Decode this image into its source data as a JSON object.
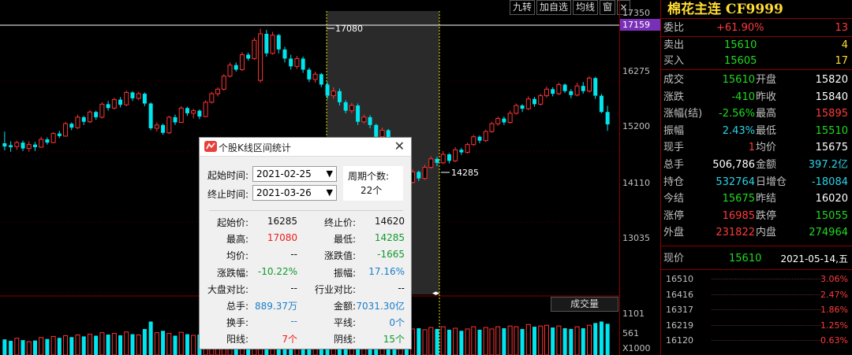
{
  "toolbar": {
    "btn1": "九转",
    "btn2": "加自选",
    "btn3": "均线",
    "btn4": "窗",
    "close": "×"
  },
  "axis": {
    "current_price": "17159",
    "labels": [
      "17350",
      "16275",
      "15200",
      "14110",
      "13035",
      "1101",
      "561",
      "X1000"
    ]
  },
  "chart_overlay": {
    "high_marker": "17080",
    "low_marker": "14285",
    "volume_label": "成交量"
  },
  "panel": {
    "title": "棉花主连 CF9999",
    "rows": [
      {
        "l1": "委比",
        "v1": "+61.90%",
        "v2": "13"
      },
      {
        "l1": "卖出",
        "v1": "15610",
        "v2": "4"
      },
      {
        "l1": "买入",
        "v1": "15605",
        "v2": "17"
      }
    ],
    "grid": [
      {
        "l1": "成交",
        "v1": "15610",
        "l2": "开盘",
        "v2": "15820"
      },
      {
        "l1": "涨跌",
        "v1": "-410",
        "l2": "昨收",
        "v2": "15840"
      },
      {
        "l1": "涨幅(结)",
        "v1": "-2.56%",
        "l2": "最高",
        "v2": "15895"
      },
      {
        "l1": "振幅",
        "v1": "2.43%",
        "l2": "最低",
        "v2": "15510"
      },
      {
        "l1": "现手",
        "v1": "1",
        "l2": "均价",
        "v2": "15675"
      },
      {
        "l1": "总手",
        "v1": "506,786",
        "l2": "金额",
        "v2": "397.2亿"
      },
      {
        "l1": "持仓",
        "v1": "532764",
        "l2": "日增仓",
        "v2": "-18084"
      },
      {
        "l1": "今结",
        "v1": "15675",
        "l2": "昨结",
        "v2": "16020"
      },
      {
        "l1": "涨停",
        "v1": "16985",
        "l2": "跌停",
        "v2": "15055"
      },
      {
        "l1": "外盘",
        "v1": "231822",
        "l2": "内盘",
        "v2": "274964"
      }
    ],
    "now": {
      "label": "现价",
      "price": "15610",
      "date": "2021-05-14,五"
    },
    "ladder": [
      {
        "price": "16510",
        "pct": "3.06%"
      },
      {
        "price": "16416",
        "pct": "2.47%"
      },
      {
        "price": "16317",
        "pct": "1.86%"
      },
      {
        "price": "16219",
        "pct": "1.25%"
      },
      {
        "price": "16120",
        "pct": "0.63%"
      }
    ]
  },
  "dialog": {
    "title": "个股K线区间统计",
    "start_label": "起始时间:",
    "start_value": "2021-02-25",
    "end_label": "终止时间:",
    "end_value": "2021-03-26",
    "period_label": "周期个数:",
    "period_value": "22个",
    "stats": [
      {
        "l1": "起始价:",
        "v1": "16285",
        "c1": "black",
        "l2": "终止价:",
        "v2": "14620",
        "c2": "black"
      },
      {
        "l1": "最高:",
        "v1": "17080",
        "c1": "red",
        "l2": "最低:",
        "v2": "14285",
        "c2": "green"
      },
      {
        "l1": "均价:",
        "v1": "--",
        "c1": "black",
        "l2": "涨跌值:",
        "v2": "-1665",
        "c2": "green"
      },
      {
        "l1": "涨跌幅:",
        "v1": "-10.22%",
        "c1": "green",
        "l2": "振幅:",
        "v2": "17.16%",
        "c2": "blue"
      },
      {
        "l1": "大盘对比:",
        "v1": "--",
        "c1": "black",
        "l2": "行业对比:",
        "v2": "--",
        "c2": "black"
      },
      {
        "l1": "总手:",
        "v1": "889.37万",
        "c1": "blue",
        "l2": "金额:",
        "v2": "7031.30亿",
        "c2": "blue"
      },
      {
        "l1": "换手:",
        "v1": "--",
        "c1": "blue",
        "l2": "平线:",
        "v2": "0个",
        "c2": "blue"
      },
      {
        "l1": "阳线:",
        "v1": "7个",
        "c1": "red",
        "l2": "阴线:",
        "v2": "15个",
        "c2": "green"
      }
    ]
  },
  "chart_data": {
    "type": "candlestick",
    "series_colors": {
      "up": "#ff3333",
      "down": "#00e5ee"
    },
    "y_range": [
      13000,
      17350
    ],
    "candles": [
      [
        15320,
        15270,
        15210,
        15500
      ],
      [
        15290,
        15260,
        15190,
        15350
      ],
      [
        15270,
        15330,
        15220,
        15360
      ],
      [
        15330,
        15240,
        15200,
        15360
      ],
      [
        15240,
        15300,
        15190,
        15350
      ],
      [
        15300,
        15260,
        15200,
        15340
      ],
      [
        15260,
        15380,
        15250,
        15420
      ],
      [
        15380,
        15330,
        15300,
        15410
      ],
      [
        15330,
        15470,
        15320,
        15490
      ],
      [
        15470,
        15430,
        15400,
        15510
      ],
      [
        15430,
        15620,
        15420,
        15650
      ],
      [
        15620,
        15560,
        15520,
        15640
      ],
      [
        15560,
        15720,
        15540,
        15760
      ],
      [
        15720,
        15650,
        15600,
        15740
      ],
      [
        15650,
        15800,
        15630,
        15830
      ],
      [
        15800,
        15720,
        15680,
        15820
      ],
      [
        15720,
        15920,
        15700,
        15950
      ],
      [
        15920,
        15860,
        15820,
        15970
      ],
      [
        15860,
        15990,
        15840,
        16020
      ],
      [
        15990,
        15910,
        15870,
        16030
      ],
      [
        15910,
        16100,
        15890,
        16130
      ],
      [
        16100,
        16010,
        15970,
        16120
      ],
      [
        16010,
        16080,
        15980,
        16110
      ],
      [
        16080,
        15930,
        15890,
        16100
      ],
      [
        15930,
        15550,
        15520,
        15950
      ],
      [
        15550,
        15600,
        15500,
        15640
      ],
      [
        15600,
        15480,
        15450,
        15620
      ],
      [
        15480,
        15720,
        15460,
        15740
      ],
      [
        15720,
        15640,
        15600,
        15760
      ],
      [
        15640,
        15860,
        15630,
        15890
      ],
      [
        15860,
        15780,
        15740,
        15880
      ],
      [
        15780,
        15820,
        15700,
        15850
      ],
      [
        15820,
        15730,
        15690,
        15840
      ],
      [
        15730,
        15950,
        15720,
        15980
      ],
      [
        15950,
        16080,
        15930,
        16110
      ],
      [
        16080,
        16150,
        16040,
        16180
      ],
      [
        16150,
        16350,
        16130,
        16380
      ],
      [
        16350,
        16520,
        16330,
        16560
      ],
      [
        16520,
        16450,
        16420,
        16560
      ],
      [
        16450,
        16680,
        16430,
        16720
      ],
      [
        16680,
        16620,
        16590,
        16710
      ],
      [
        16620,
        16900,
        16600,
        16940
      ],
      [
        16285,
        17000,
        16250,
        17080
      ],
      [
        17000,
        16700,
        16650,
        17060
      ],
      [
        16700,
        16980,
        16680,
        17030
      ],
      [
        16980,
        16760,
        16700,
        17000
      ],
      [
        16760,
        16620,
        16560,
        16800
      ],
      [
        16620,
        16500,
        16450,
        16680
      ],
      [
        16500,
        16620,
        16460,
        16660
      ],
      [
        16620,
        16450,
        16400,
        16650
      ],
      [
        16450,
        16300,
        16260,
        16480
      ],
      [
        16300,
        16380,
        16250,
        16420
      ],
      [
        16380,
        16220,
        16180,
        16400
      ],
      [
        16220,
        16050,
        16000,
        16260
      ],
      [
        16050,
        16120,
        16000,
        16180
      ],
      [
        16120,
        15950,
        15900,
        16160
      ],
      [
        15950,
        15820,
        15780,
        15980
      ],
      [
        15820,
        15900,
        15780,
        15940
      ],
      [
        15900,
        15650,
        15600,
        15930
      ],
      [
        15650,
        15720,
        15620,
        15760
      ],
      [
        15720,
        15600,
        15550,
        15750
      ],
      [
        15600,
        15420,
        15380,
        15620
      ],
      [
        15420,
        15520,
        15380,
        15560
      ],
      [
        15520,
        15020,
        14950,
        15540
      ],
      [
        15020,
        14620,
        14285,
        15050
      ],
      [
        14620,
        14800,
        14600,
        14850
      ],
      [
        14800,
        14720,
        14680,
        14830
      ],
      [
        14720,
        14880,
        14700,
        14920
      ],
      [
        14880,
        14780,
        14740,
        14900
      ],
      [
        14780,
        14950,
        14760,
        14990
      ],
      [
        14950,
        15080,
        14930,
        15120
      ],
      [
        15080,
        15020,
        14970,
        15110
      ],
      [
        15020,
        15150,
        15000,
        15200
      ],
      [
        15150,
        15050,
        15010,
        15170
      ],
      [
        15050,
        15220,
        15030,
        15260
      ],
      [
        15220,
        15180,
        15140,
        15250
      ],
      [
        15180,
        15300,
        15160,
        15330
      ],
      [
        15300,
        15420,
        15280,
        15450
      ],
      [
        15420,
        15360,
        15320,
        15440
      ],
      [
        15360,
        15500,
        15340,
        15530
      ],
      [
        15500,
        15620,
        15480,
        15650
      ],
      [
        15620,
        15700,
        15590,
        15730
      ],
      [
        15700,
        15640,
        15600,
        15730
      ],
      [
        15640,
        15780,
        15620,
        15820
      ],
      [
        15780,
        15900,
        15760,
        15930
      ],
      [
        15900,
        15850,
        15800,
        15920
      ],
      [
        15850,
        16000,
        15830,
        16040
      ],
      [
        16000,
        15920,
        15880,
        16030
      ],
      [
        15920,
        16050,
        15900,
        16080
      ],
      [
        16050,
        16150,
        16020,
        16190
      ],
      [
        16150,
        16080,
        16040,
        16180
      ],
      [
        16080,
        16220,
        16060,
        16250
      ],
      [
        16220,
        16120,
        16090,
        16240
      ],
      [
        16120,
        16060,
        16010,
        16150
      ],
      [
        16060,
        16200,
        16040,
        16250
      ],
      [
        16200,
        16120,
        16080,
        16260
      ],
      [
        16120,
        16320,
        16100,
        16350
      ],
      [
        16320,
        16050,
        16000,
        16340
      ],
      [
        16050,
        15800,
        15780,
        16080
      ],
      [
        15800,
        15610,
        15510,
        15895
      ]
    ],
    "volumes": [
      420,
      380,
      450,
      400,
      360,
      390,
      470,
      430,
      500,
      460,
      520,
      480,
      540,
      500,
      560,
      520,
      600,
      550,
      580,
      530,
      620,
      560,
      540,
      700,
      900,
      600,
      650,
      580,
      520,
      610,
      560,
      530,
      550,
      640,
      700,
      720,
      780,
      820,
      760,
      860,
      800,
      900,
      1050,
      980,
      880,
      920,
      850,
      800,
      760,
      820,
      780,
      720,
      800,
      760,
      700,
      740,
      780,
      720,
      850,
      700,
      760,
      800,
      720,
      980,
      1080,
      820,
      760,
      700,
      720,
      680,
      740,
      700,
      760,
      680,
      720,
      650,
      700,
      760,
      680,
      740,
      700,
      760,
      720,
      780,
      760,
      700,
      820,
      760,
      780,
      800,
      740,
      780,
      720,
      700,
      760,
      720,
      800,
      860,
      900,
      840
    ]
  }
}
